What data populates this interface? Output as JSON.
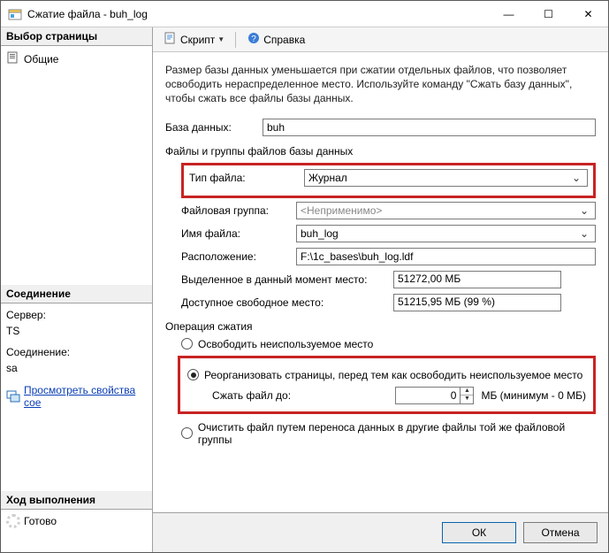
{
  "title": "Сжатие файла - buh_log",
  "window_buttons": {
    "min": "—",
    "max": "☐",
    "close": "✕"
  },
  "toolbar": {
    "script_label": "Скрипт",
    "help_label": "Справка"
  },
  "left": {
    "page_select_title": "Выбор страницы",
    "pages": {
      "general": "Общие"
    },
    "connection_title": "Соединение",
    "server_label": "Сервер:",
    "server_value": "TS",
    "conn_label": "Соединение:",
    "conn_value": "sa",
    "view_props_link": "Просмотреть свойства сое",
    "progress_title": "Ход выполнения",
    "progress_status": "Готово"
  },
  "content": {
    "description": "Размер базы данных уменьшается при сжатии отдельных файлов, что позволяет освободить нераспределенное место. Используйте команду \"Сжать базу данных\", чтобы сжать все файлы базы данных.",
    "db_label": "База данных:",
    "db_value": "buh",
    "files_group_title": "Файлы и группы файлов базы данных",
    "file_type_label": "Тип файла:",
    "file_type_value": "Журнал",
    "file_group_label": "Файловая группа:",
    "file_group_value": "<Неприменимо>",
    "file_name_label": "Имя файла:",
    "file_name_value": "buh_log",
    "location_label": "Расположение:",
    "location_value": "F:\\1c_bases\\buh_log.ldf",
    "allocated_label": "Выделенное в данный момент место:",
    "allocated_value": "51272,00 МБ",
    "free_label": "Доступное свободное место:",
    "free_value": "51215,95 МБ (99 %)",
    "op_title": "Операция сжатия",
    "op1": "Освободить неиспользуемое место",
    "op2": "Реорганизовать страницы, перед тем как освободить неиспользуемое место",
    "shrink_to_label": "Сжать файл до:",
    "shrink_to_value": "0",
    "shrink_unit": "МБ (минимум - 0 МБ)",
    "op3": "Очистить файл путем переноса данных в другие файлы той же файловой группы"
  },
  "footer": {
    "ok": "ОК",
    "cancel": "Отмена"
  }
}
